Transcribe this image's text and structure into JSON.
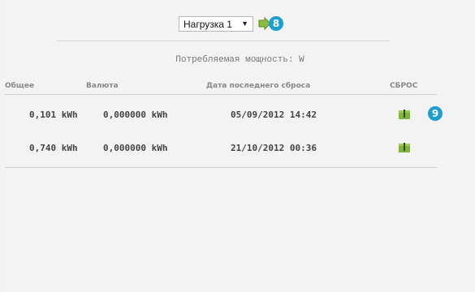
{
  "load_selector": {
    "selected": "Нагрузка 1",
    "arrow": "▼"
  },
  "badges": {
    "go_badge": "8",
    "reset_badge": "9"
  },
  "power_label": "Потребляемая мощность: W",
  "table": {
    "headers": {
      "total": "Общее",
      "currency": "Валюта",
      "last_reset_date": "Дата последнего сброса",
      "reset": "СБРОС"
    },
    "rows": [
      {
        "total": "0,101 kWh",
        "currency": "0,000000 kWh",
        "date": "05/09/2012 14:42"
      },
      {
        "total": "0,740 kWh",
        "currency": "0,000000 kWh",
        "date": "21/10/2012 00:36"
      }
    ]
  },
  "colors": {
    "accent_badge": "#1a9fcf",
    "icon_green": "#7fb33a"
  }
}
